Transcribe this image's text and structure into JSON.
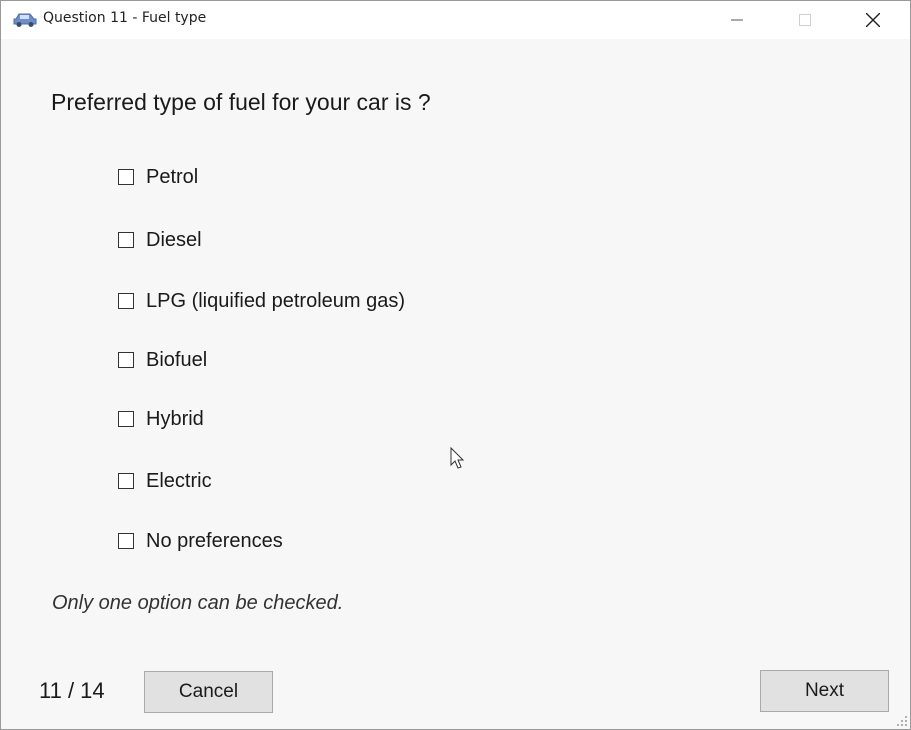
{
  "window": {
    "title": "Question 11 - Fuel type",
    "icon": "car-icon"
  },
  "question": {
    "text": "Preferred type of fuel for your car is ?"
  },
  "options": [
    {
      "label": "Petrol",
      "checked": false
    },
    {
      "label": "Diesel",
      "checked": false
    },
    {
      "label": "LPG (liquified petroleum gas)",
      "checked": false
    },
    {
      "label": "Biofuel",
      "checked": false
    },
    {
      "label": "Hybrid",
      "checked": false
    },
    {
      "label": "Electric",
      "checked": false
    },
    {
      "label": "No preferences",
      "checked": false
    }
  ],
  "hint": "Only one option can be checked.",
  "footer": {
    "counter": "11 / 14",
    "cancel_label": "Cancel",
    "next_label": "Next"
  },
  "colors": {
    "button_bg": "#e1e1e1",
    "window_bg": "#f7f7f7"
  }
}
